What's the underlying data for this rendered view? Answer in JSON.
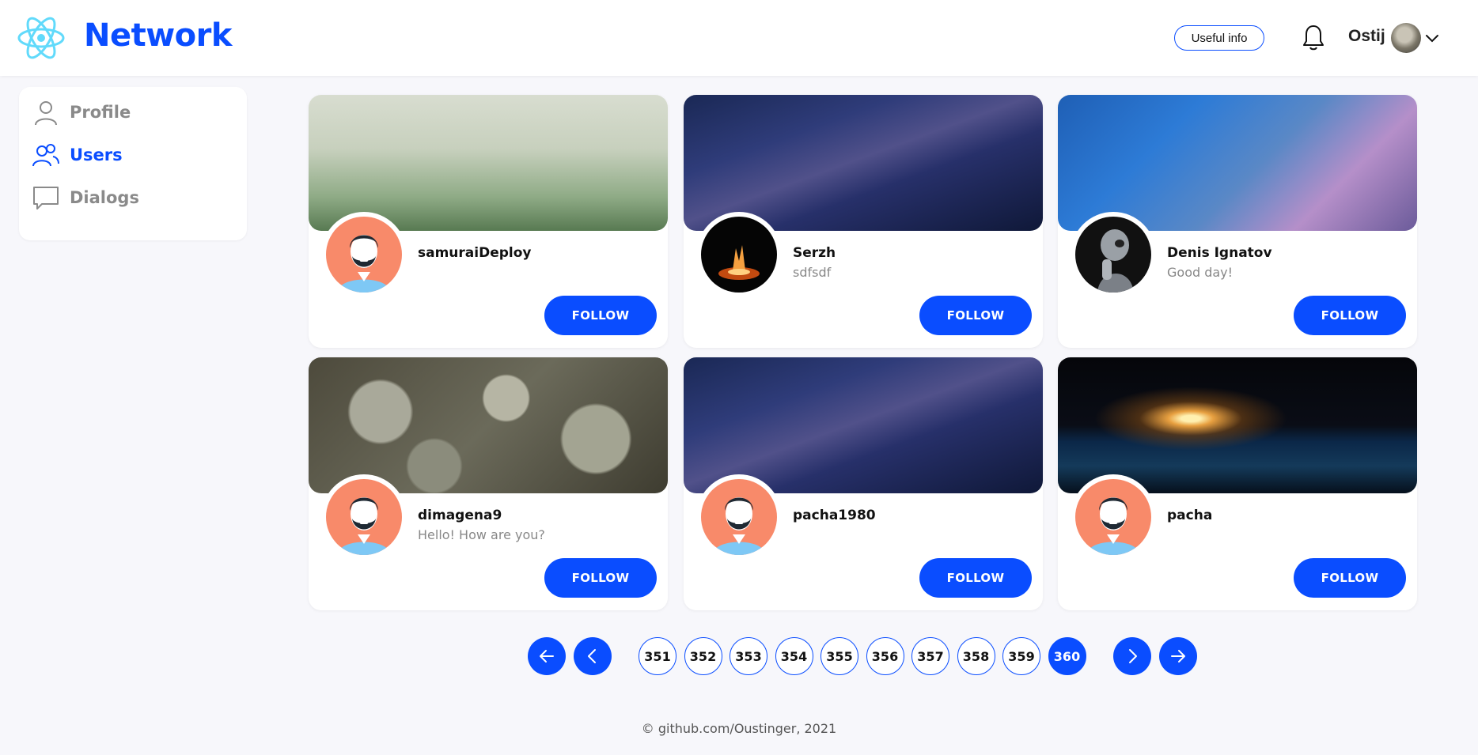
{
  "header": {
    "brand": "Network",
    "useful_info_label": "Useful info",
    "user_name": "Ostij"
  },
  "sidebar": {
    "items": [
      {
        "label": "Profile",
        "icon": "user-icon",
        "active": false
      },
      {
        "label": "Users",
        "icon": "users-icon",
        "active": true
      },
      {
        "label": "Dialogs",
        "icon": "chat-icon",
        "active": false
      }
    ]
  },
  "users": [
    {
      "name": "samuraiDeploy",
      "status": "",
      "cover": "forest",
      "avatar": "default",
      "button": "FOLLOW"
    },
    {
      "name": "Serzh",
      "status": "sdfsdf",
      "cover": "space",
      "avatar": "fire",
      "button": "FOLLOW"
    },
    {
      "name": "Denis Ignatov",
      "status": "Good day!",
      "cover": "storm",
      "avatar": "robot",
      "button": "FOLLOW"
    },
    {
      "name": "dimagena9",
      "status": "Hello! How are you?",
      "cover": "succulents",
      "avatar": "default",
      "button": "FOLLOW"
    },
    {
      "name": "pacha1980",
      "status": "",
      "cover": "space",
      "avatar": "default",
      "button": "FOLLOW"
    },
    {
      "name": "pacha",
      "status": "",
      "cover": "earth",
      "avatar": "default",
      "button": "FOLLOW"
    }
  ],
  "pagination": {
    "pages": [
      "351",
      "352",
      "353",
      "354",
      "355",
      "356",
      "357",
      "358",
      "359",
      "360"
    ],
    "current": "360"
  },
  "footer": {
    "text": "© github.com/Oustinger, 2021"
  },
  "colors": {
    "accent": "#0a4dff",
    "background": "#f7f7fb",
    "avatar_bg": "#f88a6a",
    "avatar_shirt": "#7ec8f5"
  }
}
